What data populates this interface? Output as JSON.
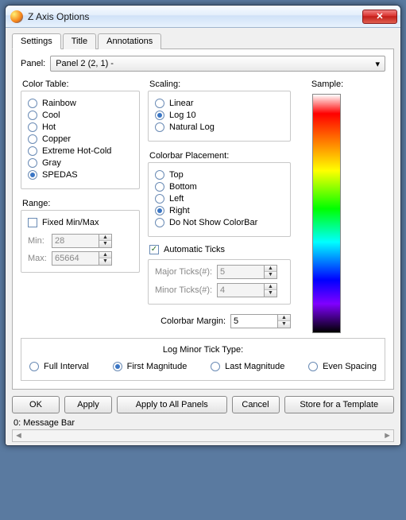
{
  "window": {
    "title": "Z Axis Options"
  },
  "tabs": [
    "Settings",
    "Title",
    "Annotations"
  ],
  "active_tab": 0,
  "panel": {
    "label": "Panel:",
    "value": "Panel 2 (2, 1)  -"
  },
  "color_table": {
    "label": "Color Table:",
    "options": [
      "Rainbow",
      "Cool",
      "Hot",
      "Copper",
      "Extreme Hot-Cold",
      "Gray",
      "SPEDAS"
    ],
    "selected": "SPEDAS"
  },
  "range": {
    "label": "Range:",
    "fixed_label": "Fixed Min/Max",
    "fixed": false,
    "min_label": "Min:",
    "min": "28",
    "max_label": "Max:",
    "max": "65664"
  },
  "scaling": {
    "label": "Scaling:",
    "options": [
      "Linear",
      "Log 10",
      "Natural Log"
    ],
    "selected": "Log 10"
  },
  "placement": {
    "label": "Colorbar Placement:",
    "options": [
      "Top",
      "Bottom",
      "Left",
      "Right",
      "Do Not Show ColorBar"
    ],
    "selected": "Right"
  },
  "auto_ticks": {
    "label": "Automatic Ticks",
    "checked": true
  },
  "major_ticks": {
    "label": "Major Ticks(#):",
    "value": "5"
  },
  "minor_ticks": {
    "label": "Minor Ticks(#):",
    "value": "4"
  },
  "margin": {
    "label": "Colorbar Margin:",
    "value": "5"
  },
  "sample_label": "Sample:",
  "log_tick": {
    "label": "Log Minor Tick Type:",
    "options": [
      "Full Interval",
      "First Magnitude",
      "Last Magnitude",
      "Even Spacing"
    ],
    "selected": "First Magnitude"
  },
  "buttons": {
    "ok": "OK",
    "apply": "Apply",
    "apply_all": "Apply to All Panels",
    "cancel": "Cancel",
    "store": "Store for a Template"
  },
  "message_bar": "0: Message Bar"
}
